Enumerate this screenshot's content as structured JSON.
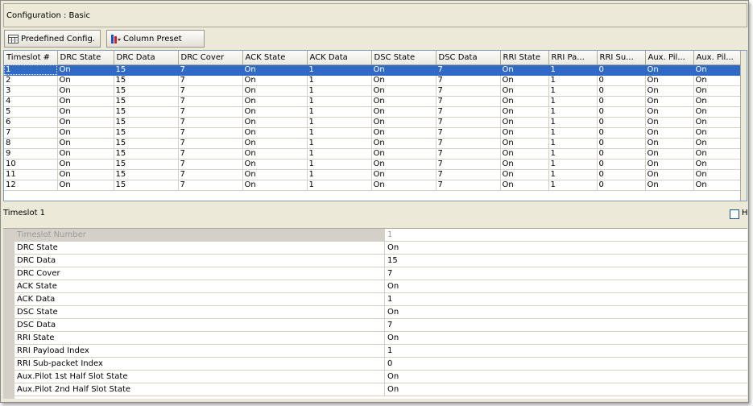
{
  "header": {
    "config_label": "Configuration : Basic"
  },
  "toolbar": {
    "predefined_label": "Predefined Config.",
    "column_preset_label": "Column Preset"
  },
  "grid": {
    "columns": [
      "Timeslot #",
      "DRC State",
      "DRC Data",
      "DRC Cover",
      "ACK State",
      "ACK Data",
      "DSC State",
      "DSC Data",
      "RRI State",
      "RRI Pa...",
      "RRI Su...",
      "Aux. Pil...",
      "Aux. Pil..."
    ],
    "selected_row": 0,
    "rows": [
      [
        "1",
        "On",
        "15",
        "7",
        "On",
        "1",
        "On",
        "7",
        "On",
        "1",
        "0",
        "On",
        "On"
      ],
      [
        "2",
        "On",
        "15",
        "7",
        "On",
        "1",
        "On",
        "7",
        "On",
        "1",
        "0",
        "On",
        "On"
      ],
      [
        "3",
        "On",
        "15",
        "7",
        "On",
        "1",
        "On",
        "7",
        "On",
        "1",
        "0",
        "On",
        "On"
      ],
      [
        "4",
        "On",
        "15",
        "7",
        "On",
        "1",
        "On",
        "7",
        "On",
        "1",
        "0",
        "On",
        "On"
      ],
      [
        "5",
        "On",
        "15",
        "7",
        "On",
        "1",
        "On",
        "7",
        "On",
        "1",
        "0",
        "On",
        "On"
      ],
      [
        "6",
        "On",
        "15",
        "7",
        "On",
        "1",
        "On",
        "7",
        "On",
        "1",
        "0",
        "On",
        "On"
      ],
      [
        "7",
        "On",
        "15",
        "7",
        "On",
        "1",
        "On",
        "7",
        "On",
        "1",
        "0",
        "On",
        "On"
      ],
      [
        "8",
        "On",
        "15",
        "7",
        "On",
        "1",
        "On",
        "7",
        "On",
        "1",
        "0",
        "On",
        "On"
      ],
      [
        "9",
        "On",
        "15",
        "7",
        "On",
        "1",
        "On",
        "7",
        "On",
        "1",
        "0",
        "On",
        "On"
      ],
      [
        "10",
        "On",
        "15",
        "7",
        "On",
        "1",
        "On",
        "7",
        "On",
        "1",
        "0",
        "On",
        "On"
      ],
      [
        "11",
        "On",
        "15",
        "7",
        "On",
        "1",
        "On",
        "7",
        "On",
        "1",
        "0",
        "On",
        "On"
      ],
      [
        "12",
        "On",
        "15",
        "7",
        "On",
        "1",
        "On",
        "7",
        "On",
        "1",
        "0",
        "On",
        "On"
      ]
    ]
  },
  "detail": {
    "title": "Timeslot 1",
    "checkbox_label": "H",
    "properties": [
      {
        "name": "Timeslot Number",
        "value": "1",
        "disabled": true
      },
      {
        "name": "DRC State",
        "value": "On"
      },
      {
        "name": "DRC Data",
        "value": "15"
      },
      {
        "name": "DRC Cover",
        "value": "7"
      },
      {
        "name": "ACK State",
        "value": "On"
      },
      {
        "name": "ACK Data",
        "value": "1"
      },
      {
        "name": "DSC State",
        "value": "On"
      },
      {
        "name": "DSC Data",
        "value": "7"
      },
      {
        "name": "RRI State",
        "value": "On"
      },
      {
        "name": "RRI Payload Index",
        "value": "1"
      },
      {
        "name": "RRI Sub-packet Index",
        "value": "0"
      },
      {
        "name": "Aux.Pilot 1st Half Slot State",
        "value": "On"
      },
      {
        "name": "Aux.Pilot 2nd Half Slot State",
        "value": "On"
      }
    ]
  },
  "colors": {
    "selection": "#316ac5",
    "chrome": "#ece9d8",
    "border": "#aca899"
  },
  "icons": {
    "predefined": "table-icon",
    "column_preset": "column-preset-icon"
  }
}
